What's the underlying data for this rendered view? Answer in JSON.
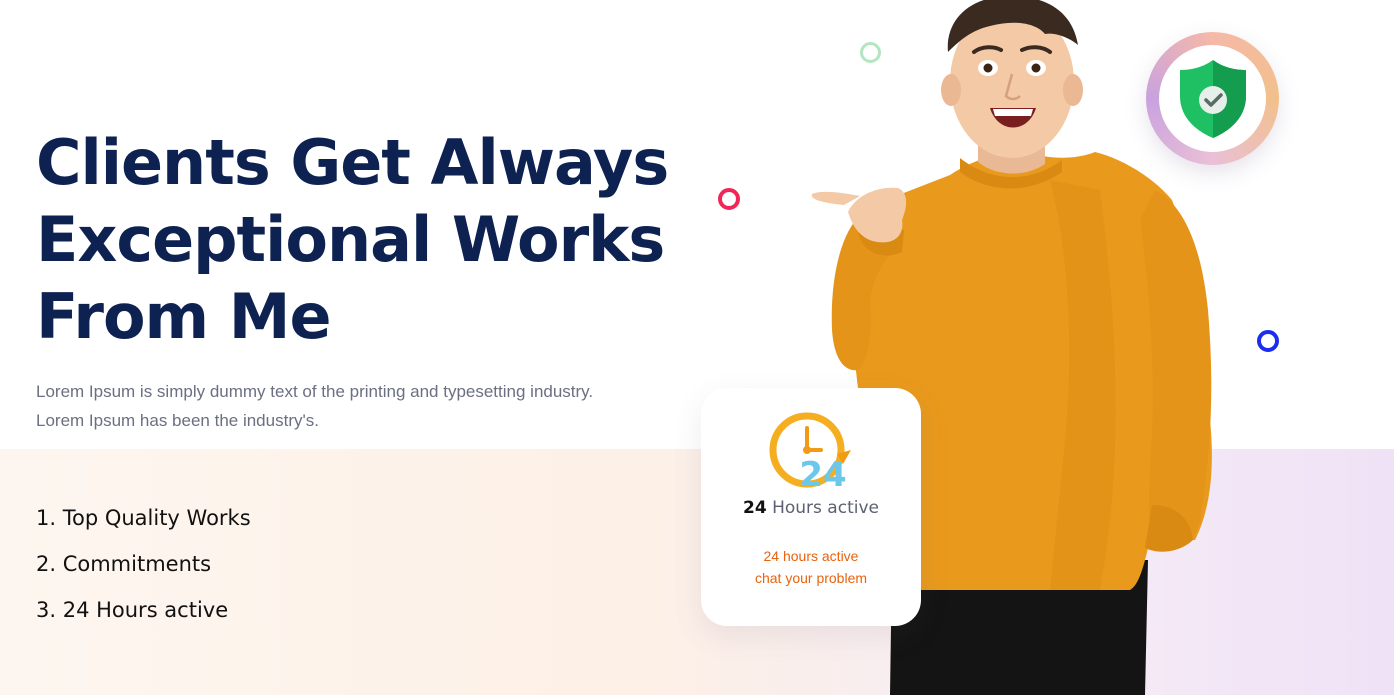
{
  "hero": {
    "headline_lines": [
      "Clients Get Always",
      "Exceptional Works",
      "From Me"
    ],
    "description_lines": [
      "Lorem Ipsum is simply dummy text of the printing and typesetting industry.",
      "Lorem Ipsum has been the industry's."
    ]
  },
  "features": [
    "1. Top Quality Works",
    "2. Commitments",
    "3. 24 Hours active"
  ],
  "active_card": {
    "icon": "24-hour-clock-icon",
    "clock_number": "24",
    "title_number": "24",
    "title_text": "Hours active",
    "subtitle_lines": [
      "24 hours active",
      "chat your problem"
    ]
  },
  "badge": {
    "icon": "shield-check-icon"
  },
  "colors": {
    "headline": "#0e2252",
    "accent_orange": "#e8630f",
    "shield_green": "#1fbf63",
    "ring_green": "#b3e6c0",
    "ring_red": "#f0285a",
    "ring_blue": "#1c2cf0",
    "sweater": "#e99a1d"
  }
}
